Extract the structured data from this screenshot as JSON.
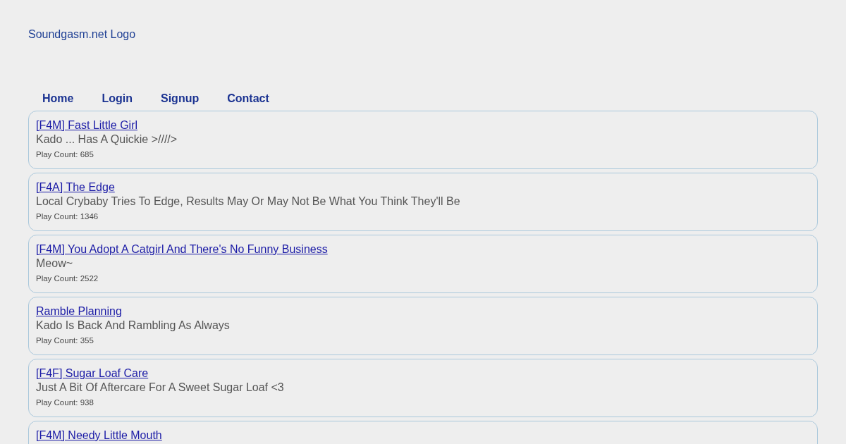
{
  "logo": "Soundgasm.net Logo",
  "nav": [
    "Home",
    "Login",
    "Signup",
    "Contact"
  ],
  "sounds": [
    {
      "title": "[F4M] Fast Little Girl",
      "description": "Kado ... Has A Quickie >////>",
      "play_count": "Play Count: 685"
    },
    {
      "title": "[F4A] The Edge",
      "description": "Local Crybaby Tries To Edge, Results May Or May Not Be What You Think They'll Be",
      "play_count": "Play Count: 1346"
    },
    {
      "title": "[F4M] You Adopt A Catgirl And There's No Funny Business",
      "description": "Meow~",
      "play_count": "Play Count: 2522"
    },
    {
      "title": "Ramble Planning",
      "description": "Kado Is Back And Rambling As Always",
      "play_count": "Play Count: 355"
    },
    {
      "title": "[F4F] Sugar Loaf Care",
      "description": "Just A Bit Of Aftercare For A Sweet Sugar Loaf <3",
      "play_count": "Play Count: 938"
    },
    {
      "title": "[F4M] Needy Little Mouth"
    }
  ]
}
